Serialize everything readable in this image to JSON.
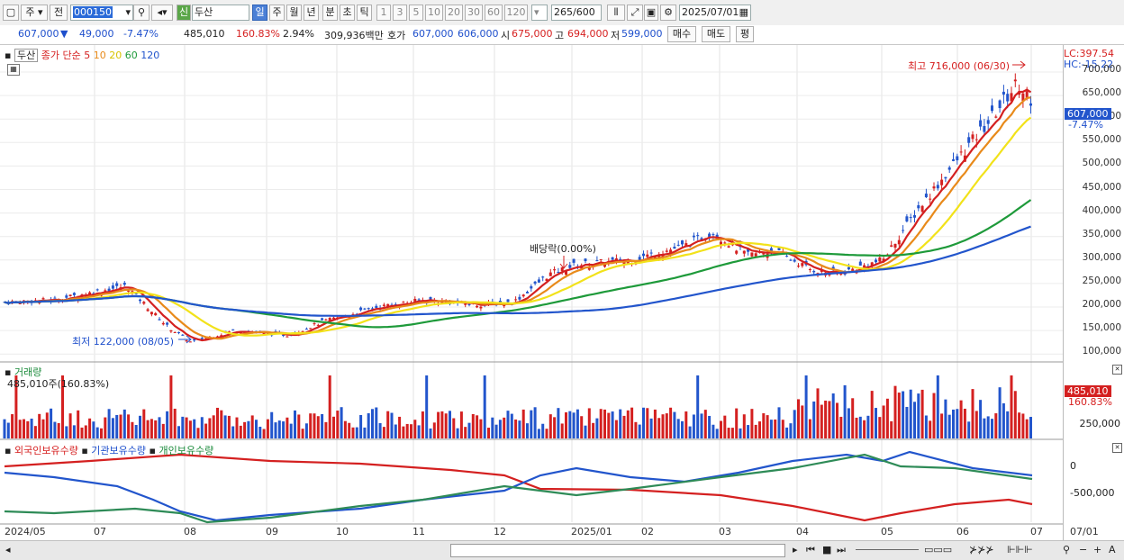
{
  "toolbar": {
    "market": "주",
    "prev": "전",
    "code": "000150",
    "sin": "신",
    "name": "두산",
    "periods": [
      "일",
      "주",
      "월",
      "년",
      "분",
      "초",
      "틱"
    ],
    "active_period": "일",
    "nums": [
      "1",
      "3",
      "5",
      "10",
      "20",
      "30",
      "60",
      "120"
    ],
    "count": "265",
    "count_total": "/600",
    "date": "2025/07/01"
  },
  "quote": {
    "price": "607,000",
    "arrow": "▼",
    "change": "49,000",
    "pct": "-7.47%",
    "volume": "485,010",
    "vol_ratio": "160.83%",
    "turnover": "2.94%",
    "amount": "309,936백만",
    "hoga_label": "호가",
    "ask": "607,000",
    "bid": "606,000",
    "open_label": "시",
    "open": "675,000",
    "high_label": "고",
    "high": "694,000",
    "low_label": "저",
    "low": "599,000",
    "buy": "매수",
    "sell": "매도",
    "avg": "평"
  },
  "legend": {
    "title": "두산",
    "price_label": "종가 단순",
    "ma": [
      "5",
      "10",
      "20",
      "60",
      "120"
    ],
    "ma_colors": [
      "#d42020",
      "#e88a1a",
      "#f2e21a",
      "#1e9a3a",
      "#2255cc"
    ]
  },
  "price_axis": {
    "lc": "LC:397.54",
    "hc": "HC:-15.22",
    "ticks": [
      "700,000",
      "650,000",
      "600,000",
      "550,000",
      "500,000",
      "450,000",
      "400,000",
      "350,000",
      "300,000",
      "250,000",
      "200,000",
      "150,000",
      "100,000"
    ],
    "last": "607,000",
    "last_pct": "-7.47%"
  },
  "annotations": {
    "high": "최고 716,000 (06/30)",
    "low": "최저 122,000 (08/05)",
    "dividend": "배당락(0.00%)"
  },
  "volume_pane": {
    "title": "거래량",
    "value": "485,010주(160.83%)",
    "ticks": [
      "250,000",
      "0"
    ],
    "last": "485,010",
    "last_pct": "160.83%"
  },
  "holdings_pane": {
    "labels": [
      "외국인보유수량",
      "기관보유수량",
      "개인보유수량"
    ],
    "colors": [
      "#d42020",
      "#2255cc",
      "#2e8b57"
    ],
    "ticks": [
      "0",
      "-500,000"
    ]
  },
  "x_axis": [
    "2024/05",
    "07",
    "08",
    "09",
    "10",
    "11",
    "12",
    "2025/01",
    "02",
    "03",
    "04",
    "05",
    "06",
    "07",
    "07/01"
  ]
}
